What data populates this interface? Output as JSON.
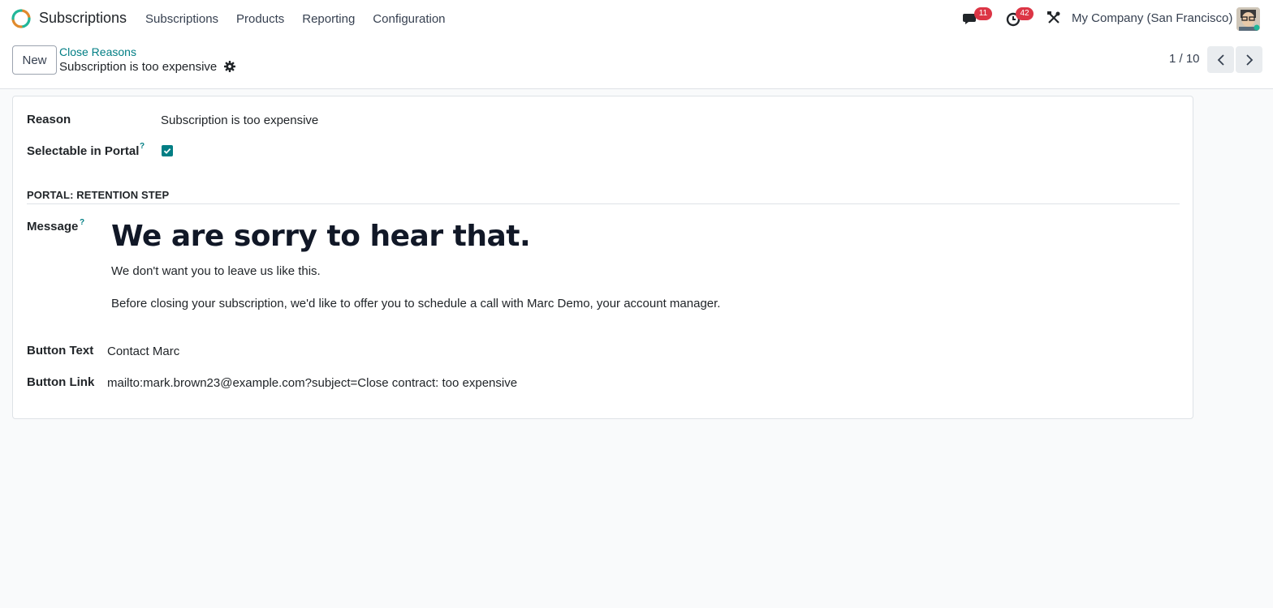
{
  "app": {
    "name": "Subscriptions",
    "menu": [
      "Subscriptions",
      "Products",
      "Reporting",
      "Configuration"
    ]
  },
  "systray": {
    "messages_count": "11",
    "activities_count": "42",
    "company": "My Company (San Francisco)"
  },
  "control_panel": {
    "new_label": "New",
    "breadcrumb": "Close Reasons",
    "record_title": "Subscription is too expensive",
    "pager_value": "1 / 10"
  },
  "form": {
    "reason_label": "Reason",
    "reason_value": "Subscription is too expensive",
    "selectable_label": "Selectable in Portal",
    "selectable_checked": true,
    "help_mark": "?",
    "section_title": "PORTAL: RETENTION STEP",
    "message_label": "Message",
    "message_heading": "We are sorry to hear that.",
    "message_line1": "We don't want you to leave us like this.",
    "message_line2": "Before closing your subscription, we'd like to offer you to schedule a call with Marc Demo, your account manager.",
    "button_text_label": "Button Text",
    "button_text_value": "Contact Marc",
    "button_link_label": "Button Link",
    "button_link_value": "mailto:mark.brown23@example.com?subject=Close contract: too expensive"
  },
  "colors": {
    "accent": "#017e84",
    "badge": "#dc3545",
    "background": "#f9fafb"
  }
}
